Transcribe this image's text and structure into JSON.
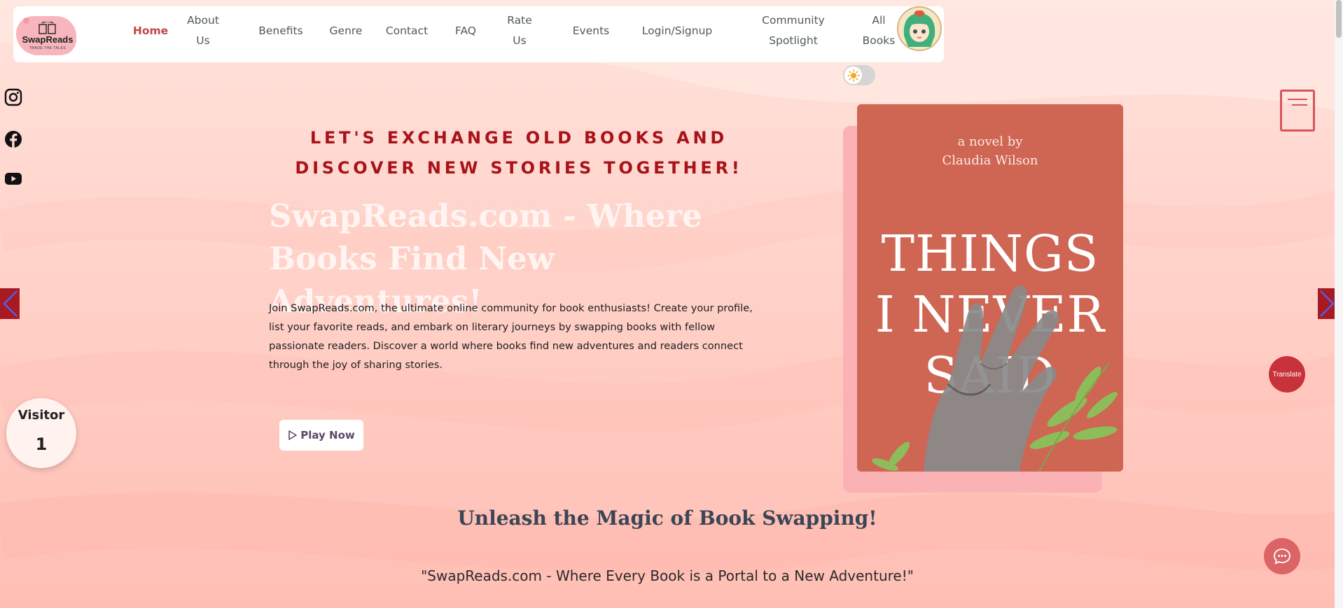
{
  "logo": {
    "text": "SwapReads",
    "tagline": "TRADE THE TALES"
  },
  "nav": {
    "items": [
      {
        "label": "Home"
      },
      {
        "label": "About Us"
      },
      {
        "label": "Benefits"
      },
      {
        "label": "Genre"
      },
      {
        "label": "Contact"
      },
      {
        "label": "FAQ"
      },
      {
        "label": "Rate Us"
      },
      {
        "label": "Events"
      },
      {
        "label": "Login/Signup"
      },
      {
        "label": "Community Spotlight"
      },
      {
        "label": "All Books"
      }
    ]
  },
  "hero": {
    "tagline": "LET'S EXCHANGE OLD BOOKS AND DISCOVER NEW STORIES TOGETHER!",
    "title": "SwapReads.com - Where Books Find New Adventures!",
    "description": "Join SwapReads.com, the ultimate online community for book enthusiasts! Create your profile, list your favorite reads, and embark on literary journeys by swapping books with fellow passionate readers. Discover a world where books find new adventures and readers connect through the joy of sharing stories.",
    "play_button": "Play Now"
  },
  "book": {
    "byline_1": "a novel by",
    "byline_2": "Claudia Wilson",
    "title_1": "THINGS",
    "title_2": "I NEVER",
    "title_3": "SAID"
  },
  "visitor": {
    "label": "Visitor",
    "count": "1"
  },
  "translate": {
    "label": "Translate"
  },
  "section": {
    "heading": "Unleash the Magic of Book Swapping!",
    "quote": "\"SwapReads.com - Where Every Book is a Portal to a New Adventure!\""
  },
  "icons": {
    "social": [
      "instagram-icon",
      "facebook-icon",
      "youtube-icon"
    ],
    "theme": "sun-icon",
    "chat": "chat-icon"
  },
  "colors": {
    "brand_red": "#a8131a",
    "nav_active": "#c0474a",
    "book_cover": "#cf6553",
    "heading_text": "#3a4656"
  }
}
